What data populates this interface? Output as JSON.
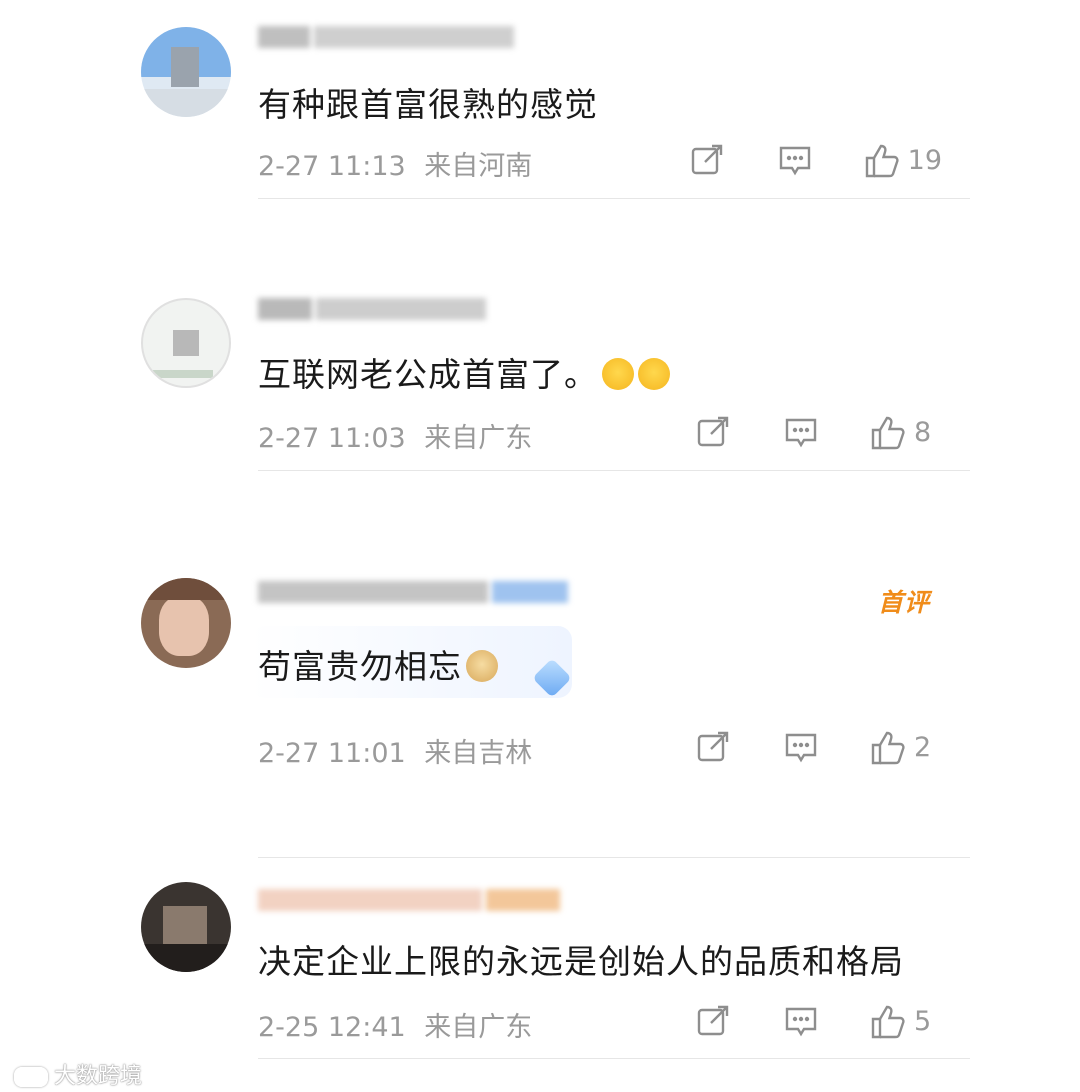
{
  "comments": [
    {
      "text": "有种跟首富很熟的感觉",
      "time": "2-27 11:13",
      "location": "来自河南",
      "likes": "19",
      "badge": ""
    },
    {
      "text": "互联网老公成首富了。",
      "time": "2-27 11:03",
      "location": "来自广东",
      "likes": "8",
      "badge": ""
    },
    {
      "text": "苟富贵勿相忘",
      "time": "2-27 11:01",
      "location": "来自吉林",
      "likes": "2",
      "badge": "首评"
    },
    {
      "text": "决定企业上限的永远是创始人的品质和格局",
      "time": "2-25 12:41",
      "location": "来自广东",
      "likes": "5",
      "badge": ""
    }
  ],
  "icons": {
    "share": "share-icon",
    "reply": "comment-icon",
    "like": "thumbs-up-icon"
  },
  "watermark": "大数跨境",
  "colors": {
    "meta_gray": "#9a9a9a",
    "badge_orange": "#f08c1a",
    "divider": "#e6e6e6"
  }
}
